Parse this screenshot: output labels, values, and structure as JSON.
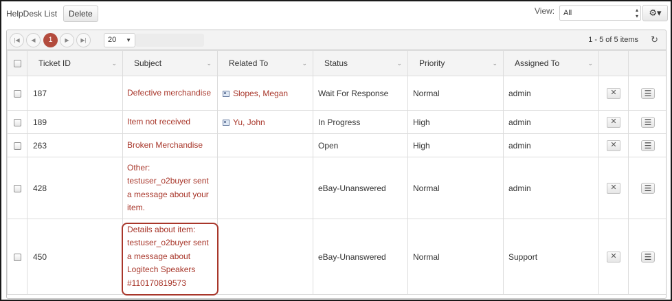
{
  "toolbar": {
    "title": "HelpDesk List",
    "delete_label": "Delete",
    "view_label": "View:",
    "view_value": "All"
  },
  "pager": {
    "current_page": "1",
    "page_size": "20",
    "items_info": "1 - 5 of 5 items"
  },
  "columns": [
    "Ticket ID",
    "Subject",
    "Related To",
    "Status",
    "Priority",
    "Assigned To"
  ],
  "rows": [
    {
      "id": "187",
      "subject": "Defective merchandise",
      "related": "Slopes, Megan",
      "status": "Wait For Response",
      "priority": "Normal",
      "assigned": "admin"
    },
    {
      "id": "189",
      "subject": "Item not received",
      "related": "Yu, John",
      "status": "In Progress",
      "priority": "High",
      "assigned": "admin"
    },
    {
      "id": "263",
      "subject": "Broken Merchandise",
      "related": "",
      "status": "Open",
      "priority": "High",
      "assigned": "admin"
    },
    {
      "id": "428",
      "subject": "Other: testuser_o2buyer sent a message about your item.",
      "related": "",
      "status": "eBay-Unanswered",
      "priority": "Normal",
      "assigned": "admin"
    },
    {
      "id": "450",
      "subject": "Details about item: testuser_o2buyer sent a message about Logitech Speakers #110170819573",
      "related": "",
      "status": "eBay-Unanswered",
      "priority": "Normal",
      "assigned": "Support"
    }
  ],
  "icons": {
    "gear": "gear-icon",
    "refresh": "refresh-icon",
    "contact": "contact-card-icon",
    "delete_row": "close-icon",
    "row_menu": "menu-icon"
  },
  "colors": {
    "accent": "#b34b3d",
    "link": "#a8362a"
  }
}
